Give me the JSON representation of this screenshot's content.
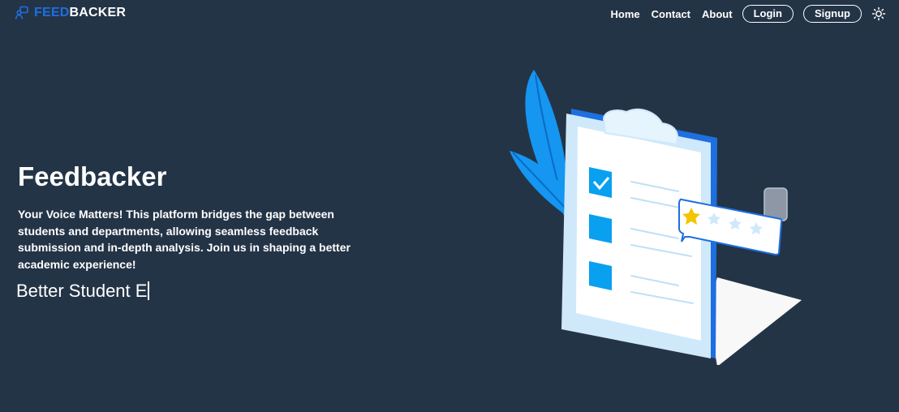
{
  "navbar": {
    "brand": {
      "part_a": "FEED",
      "part_b": "BACKER",
      "logo_icon": "feedback-people-icon"
    },
    "links": [
      {
        "label": "Home"
      },
      {
        "label": "Contact"
      },
      {
        "label": "About"
      }
    ],
    "login_label": "Login",
    "signup_label": "Signup",
    "theme_toggle_icon": "sun-icon"
  },
  "hero": {
    "title": "Feedbacker",
    "description": "Your Voice Matters! This platform bridges the gap between students and departments, allowing seamless feedback submission and in-depth analysis. Join us in shaping a better academic experience!",
    "typed_text": "Better Student E"
  },
  "illustration": {
    "icon": "clipboard-checklist-rating-illustration",
    "colors": {
      "accent": "#1e6fe0",
      "bright_blue": "#0aa0f0",
      "leaf": "#1596f0",
      "paper": "#ffffff",
      "shadow": "#ffffff",
      "star": "#f5c400"
    }
  }
}
